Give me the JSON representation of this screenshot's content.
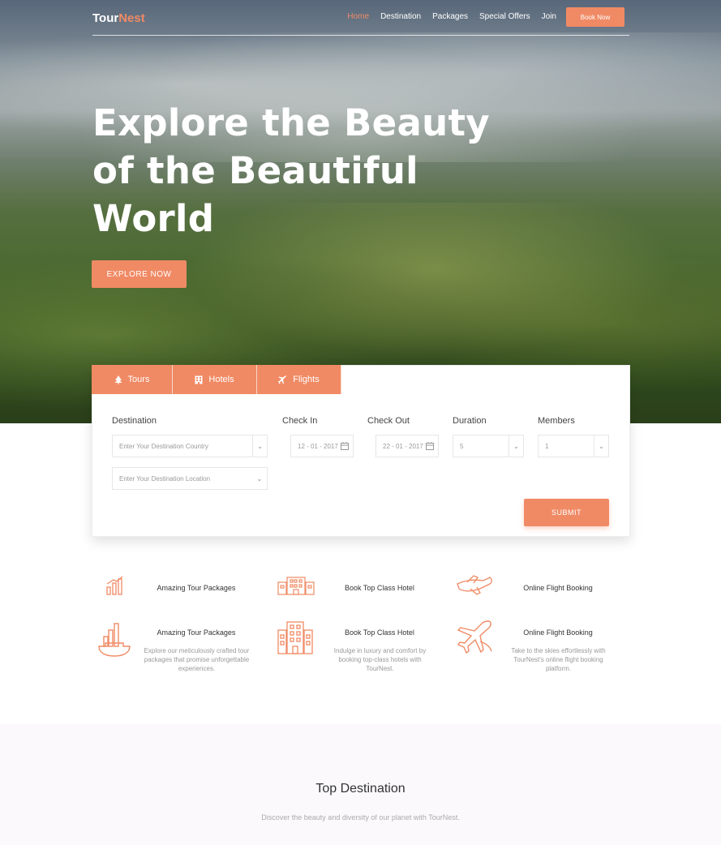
{
  "brand": {
    "logo_main": "Tour",
    "logo_accent": "Nest",
    "accent_color": "#f08a65"
  },
  "nav": {
    "links": [
      "Home",
      "Destination",
      "Packages",
      "Special Offers",
      "Join"
    ],
    "active": "Home",
    "book_label": "Book Now"
  },
  "hero": {
    "title_line1": "Explore the Beauty",
    "title_line2": "of the Beautiful",
    "title_line3": "World",
    "cta_label": "EXPLORE NOW"
  },
  "search": {
    "tabs": [
      {
        "label": "Tours",
        "icon": "tree-icon"
      },
      {
        "label": "Hotels",
        "icon": "hotel-icon"
      },
      {
        "label": "Flights",
        "icon": "plane-icon"
      }
    ],
    "labels": {
      "destination": "Destination",
      "check_in": "Check In",
      "check_out": "Check Out",
      "duration": "Duration",
      "members": "Members"
    },
    "destination_country_placeholder": "Enter Your Destination Country",
    "destination_location_placeholder": "Enter Your Destination Location",
    "check_in_value": "12 - 01 - 2017",
    "check_out_value": "22 - 01 - 2017",
    "duration_value": "5",
    "members_value": "1",
    "submit_label": "SUBMIT"
  },
  "features_top": [
    {
      "title": "Amazing Tour Packages",
      "icon": "chart-bars-icon"
    },
    {
      "title": "Book Top Class Hotel",
      "icon": "hotel-building-icon"
    },
    {
      "title": "Online Flight Booking",
      "icon": "plane-icon"
    }
  ],
  "features": [
    {
      "title": "Amazing Tour Packages",
      "desc_line1": "Explore our meticulously crafted tour",
      "desc_line2": "packages that promise unforgettable",
      "desc_line3": "experiences.",
      "icon": "tour-package-icon"
    },
    {
      "title": "Book Top Class Hotel",
      "desc_line1": "Indulge in luxury and comfort by",
      "desc_line2": "booking top-class hotels with",
      "desc_line3": "TourNest.",
      "icon": "hotel-building-icon"
    },
    {
      "title": "Online Flight Booking",
      "desc_line1": "Take to the skies effortlessly with",
      "desc_line2": "TourNest's online flight booking",
      "desc_line3": "platform.",
      "icon": "plane-icon"
    }
  ],
  "top_destination": {
    "title": "Top Destination",
    "subtitle": "Discover the beauty and diversity of our planet with TourNest."
  }
}
